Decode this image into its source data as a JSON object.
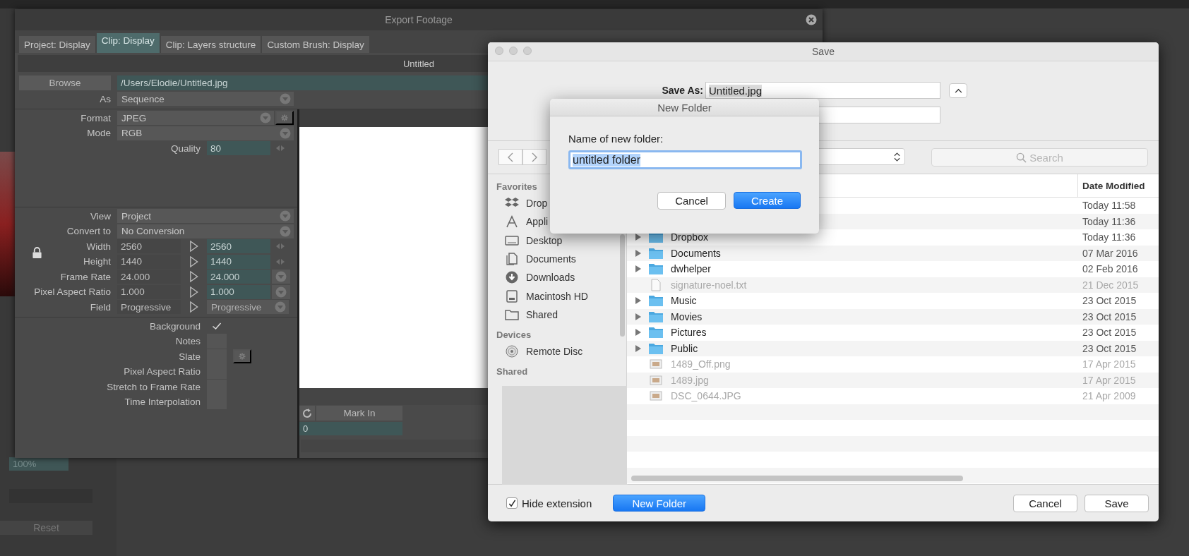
{
  "background_panel": {
    "zoom_field": "100%",
    "reset_button": "Reset"
  },
  "export_window": {
    "title": "Export Footage",
    "tabs": [
      {
        "label": "Project: Display",
        "selected": false
      },
      {
        "label": "Clip: Display",
        "selected": true
      },
      {
        "label": "Clip: Layers structure",
        "selected": false
      },
      {
        "label": "Custom Brush: Display",
        "selected": false
      }
    ],
    "clip_name": "Untitled",
    "browse_button": "Browse",
    "path": "/Users/Elodie/Untitled.jpg",
    "sections": [
      {
        "rows": [
          {
            "kind": "select",
            "label": "As",
            "value": "Sequence"
          }
        ]
      },
      {
        "rows": [
          {
            "kind": "select_gear",
            "label": "Format",
            "value": "JPEG"
          },
          {
            "kind": "select",
            "label": "Mode",
            "value": "RGB"
          },
          {
            "kind": "spin",
            "label": "Quality",
            "value": "80"
          }
        ]
      },
      {
        "rows": [
          {
            "kind": "select",
            "label": "View",
            "value": "Project"
          },
          {
            "kind": "select",
            "label": "Convert to",
            "value": "No Conversion"
          },
          {
            "kind": "pair_spin",
            "label": "Width",
            "value": "2560",
            "target": "2560"
          },
          {
            "kind": "pair_spin",
            "label": "Height",
            "value": "1440",
            "target": "1440"
          },
          {
            "kind": "pair_select",
            "label": "Frame Rate",
            "value": "24.000",
            "target": "24.000"
          },
          {
            "kind": "pair_select",
            "label": "Pixel Aspect Ratio",
            "value": "1.000",
            "target": "1.000"
          },
          {
            "kind": "pair_menu",
            "label": "Field",
            "value": "Progressive",
            "target": "Progressive"
          }
        ]
      },
      {
        "rows": [
          {
            "kind": "check",
            "label": "Background",
            "checked": true
          },
          {
            "kind": "check",
            "label": "Notes",
            "checked": false
          },
          {
            "kind": "check_gear",
            "label": "Slate",
            "checked": false
          },
          {
            "kind": "check",
            "label": "Pixel Aspect Ratio",
            "checked": false
          },
          {
            "kind": "check",
            "label": "Stretch to Frame Rate",
            "checked": false
          },
          {
            "kind": "check",
            "label": "Time Interpolation",
            "checked": false
          }
        ]
      }
    ],
    "mark_in_button": "Mark In",
    "mark_in_value": "0"
  },
  "save_dialog": {
    "title": "Save",
    "save_as_label": "Save As:",
    "filename": "Untitled.jpg",
    "search_placeholder": "Search",
    "sidebar": [
      {
        "header": "Favorites",
        "items": [
          {
            "label": "Drop",
            "kind": "dropbox"
          },
          {
            "label": "Appli",
            "kind": "applications"
          },
          {
            "label": "Desktop",
            "kind": "desktop"
          },
          {
            "label": "Documents",
            "kind": "documents"
          },
          {
            "label": "Downloads",
            "kind": "downloads"
          },
          {
            "label": "Macintosh HD",
            "kind": "drive"
          },
          {
            "label": "Shared",
            "kind": "shared"
          }
        ]
      },
      {
        "header": "Devices",
        "items": [
          {
            "label": "Remote Disc",
            "kind": "disc"
          }
        ]
      },
      {
        "header": "Shared"
      }
    ],
    "date_column": "Date Modified",
    "files": [
      {
        "kind": "hidden",
        "date": "Today 11:58",
        "disabled": false
      },
      {
        "kind": "hidden",
        "date": "Today 11:36",
        "disabled": false
      },
      {
        "kind": "folder",
        "name": "Dropbox",
        "date": "Today 11:36",
        "disabled": false
      },
      {
        "kind": "folder",
        "name": "Documents",
        "date": "07 Mar 2016",
        "disabled": false
      },
      {
        "kind": "folder",
        "name": "dwhelper",
        "date": "02 Feb 2016",
        "disabled": false
      },
      {
        "kind": "text",
        "name": "signature-noel.txt",
        "date": "21 Dec 2015",
        "disabled": true
      },
      {
        "kind": "folder",
        "name": "Music",
        "date": "23 Oct 2015",
        "disabled": false
      },
      {
        "kind": "folder",
        "name": "Movies",
        "date": "23 Oct 2015",
        "disabled": false
      },
      {
        "kind": "folder",
        "name": "Pictures",
        "date": "23 Oct 2015",
        "disabled": false
      },
      {
        "kind": "folder",
        "name": "Public",
        "date": "23 Oct 2015",
        "disabled": false
      },
      {
        "kind": "image",
        "name": "1489_Off.png",
        "date": "17 Apr 2015",
        "disabled": true
      },
      {
        "kind": "image",
        "name": "1489.jpg",
        "date": "17 Apr 2015",
        "disabled": true
      },
      {
        "kind": "image",
        "name": "DSC_0644.JPG",
        "date": "21 Apr 2009",
        "disabled": true
      }
    ],
    "hide_extension": {
      "label": "Hide extension",
      "checked": true
    },
    "new_folder_button": "New Folder",
    "cancel_button": "Cancel",
    "save_button": "Save"
  },
  "new_folder_sheet": {
    "title": "New Folder",
    "prompt": "Name of new folder:",
    "value": "untitled folder",
    "cancel_button": "Cancel",
    "create_button": "Create"
  }
}
